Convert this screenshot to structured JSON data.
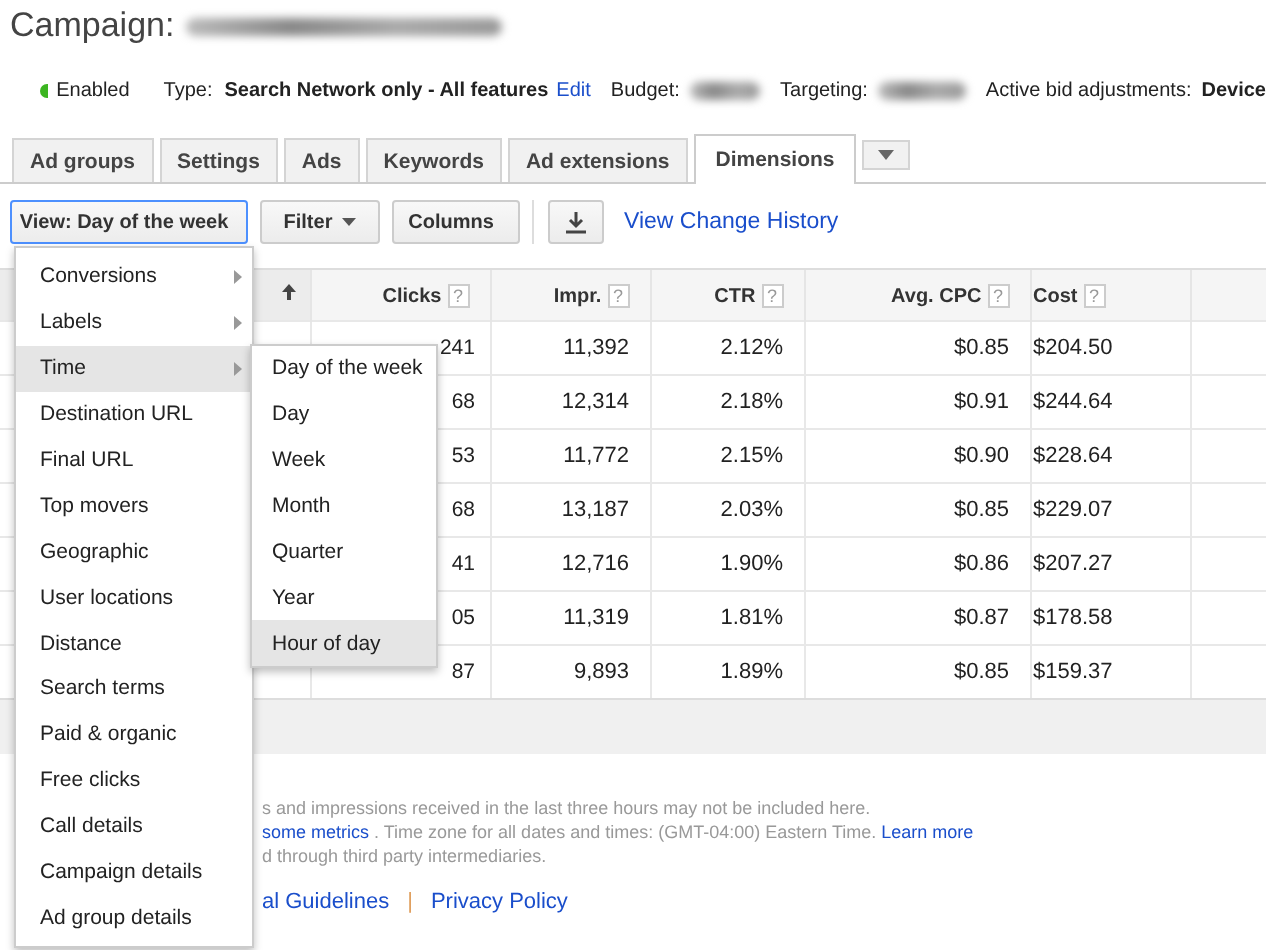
{
  "page_title": "Campaign:",
  "summary": {
    "status": "Enabled",
    "type_label": "Type:",
    "type_value": "Search Network only - All features",
    "edit_link": "Edit",
    "budget_label": "Budget:",
    "targeting_label": "Targeting:",
    "bid_label": "Active bid adjustments:",
    "bid_value": "Device"
  },
  "tabs": [
    {
      "label": "Ad groups",
      "selected": false
    },
    {
      "label": "Settings",
      "selected": false
    },
    {
      "label": "Ads",
      "selected": false
    },
    {
      "label": "Keywords",
      "selected": false
    },
    {
      "label": "Ad extensions",
      "selected": false
    },
    {
      "label": "Dimensions",
      "selected": true
    }
  ],
  "toolbar": {
    "view_button": "View: Day of the week",
    "filter_button": "Filter",
    "columns_button": "Columns",
    "history_link": "View Change History"
  },
  "table": {
    "columns": [
      {
        "label": "Clicks",
        "help": "?"
      },
      {
        "label": "Impr.",
        "help": "?"
      },
      {
        "label": "CTR",
        "help": "?"
      },
      {
        "label": "Avg. CPC",
        "help": "?"
      },
      {
        "label": "Cost",
        "help": "?"
      }
    ],
    "rows": [
      [
        "241",
        "11,392",
        "2.12%",
        "$0.85",
        "$204.50"
      ],
      [
        "68",
        "12,314",
        "2.18%",
        "$0.91",
        "$244.64"
      ],
      [
        "53",
        "11,772",
        "2.15%",
        "$0.90",
        "$228.64"
      ],
      [
        "68",
        "13,187",
        "2.03%",
        "$0.85",
        "$229.07"
      ],
      [
        "41",
        "12,716",
        "1.90%",
        "$0.86",
        "$207.27"
      ],
      [
        "05",
        "11,319",
        "1.81%",
        "$0.87",
        "$178.58"
      ],
      [
        "87",
        "9,893",
        "1.89%",
        "$0.85",
        "$159.37"
      ]
    ]
  },
  "footer": {
    "notes": [
      [
        {
          "kind": "text",
          "text": "s and impressions received in the last three hours may not be included here."
        }
      ],
      [
        {
          "kind": "link",
          "text": "some metrics"
        },
        {
          "kind": "text",
          "text": ". Time zone for all dates and times: (GMT-04:00) Eastern Time."
        },
        {
          "kind": "link",
          "text": "Learn more"
        }
      ],
      [
        {
          "kind": "text",
          "text": "d through third party intermediaries."
        }
      ]
    ],
    "links": [
      {
        "kind": "link",
        "text": "al Guidelines"
      },
      {
        "kind": "separator",
        "text": "|"
      },
      {
        "kind": "link",
        "text": "Privacy Policy"
      }
    ]
  },
  "view_menu": {
    "items": [
      {
        "label": "Conversions",
        "has_submenu": true,
        "selected": false
      },
      {
        "label": "Labels",
        "has_submenu": true,
        "selected": false
      },
      {
        "label": "Time",
        "has_submenu": true,
        "selected": true
      },
      {
        "label": "Destination URL",
        "has_submenu": false,
        "selected": false
      },
      {
        "label": "Final URL",
        "has_submenu": false,
        "selected": false
      },
      {
        "label": "Top movers",
        "has_submenu": false,
        "selected": false
      },
      {
        "label": "Geographic",
        "has_submenu": false,
        "selected": false
      },
      {
        "label": "User locations",
        "has_submenu": false,
        "selected": false
      },
      {
        "label": "Distance",
        "has_submenu": false,
        "selected": false
      },
      {
        "label": "Search terms",
        "has_submenu": false,
        "selected": false
      },
      {
        "label": "Paid & organic",
        "has_submenu": false,
        "selected": false
      },
      {
        "label": "Free clicks",
        "has_submenu": false,
        "selected": false
      },
      {
        "label": "Call details",
        "has_submenu": false,
        "selected": false
      },
      {
        "label": "Campaign details",
        "has_submenu": false,
        "selected": false
      },
      {
        "label": "Ad group details",
        "has_submenu": false,
        "selected": false
      }
    ],
    "submenu": [
      {
        "label": "Day of the week",
        "selected": false
      },
      {
        "label": "Day",
        "selected": false
      },
      {
        "label": "Week",
        "selected": false
      },
      {
        "label": "Month",
        "selected": false
      },
      {
        "label": "Quarter",
        "selected": false
      },
      {
        "label": "Year",
        "selected": false
      },
      {
        "label": "Hour of day",
        "selected": true
      }
    ]
  }
}
